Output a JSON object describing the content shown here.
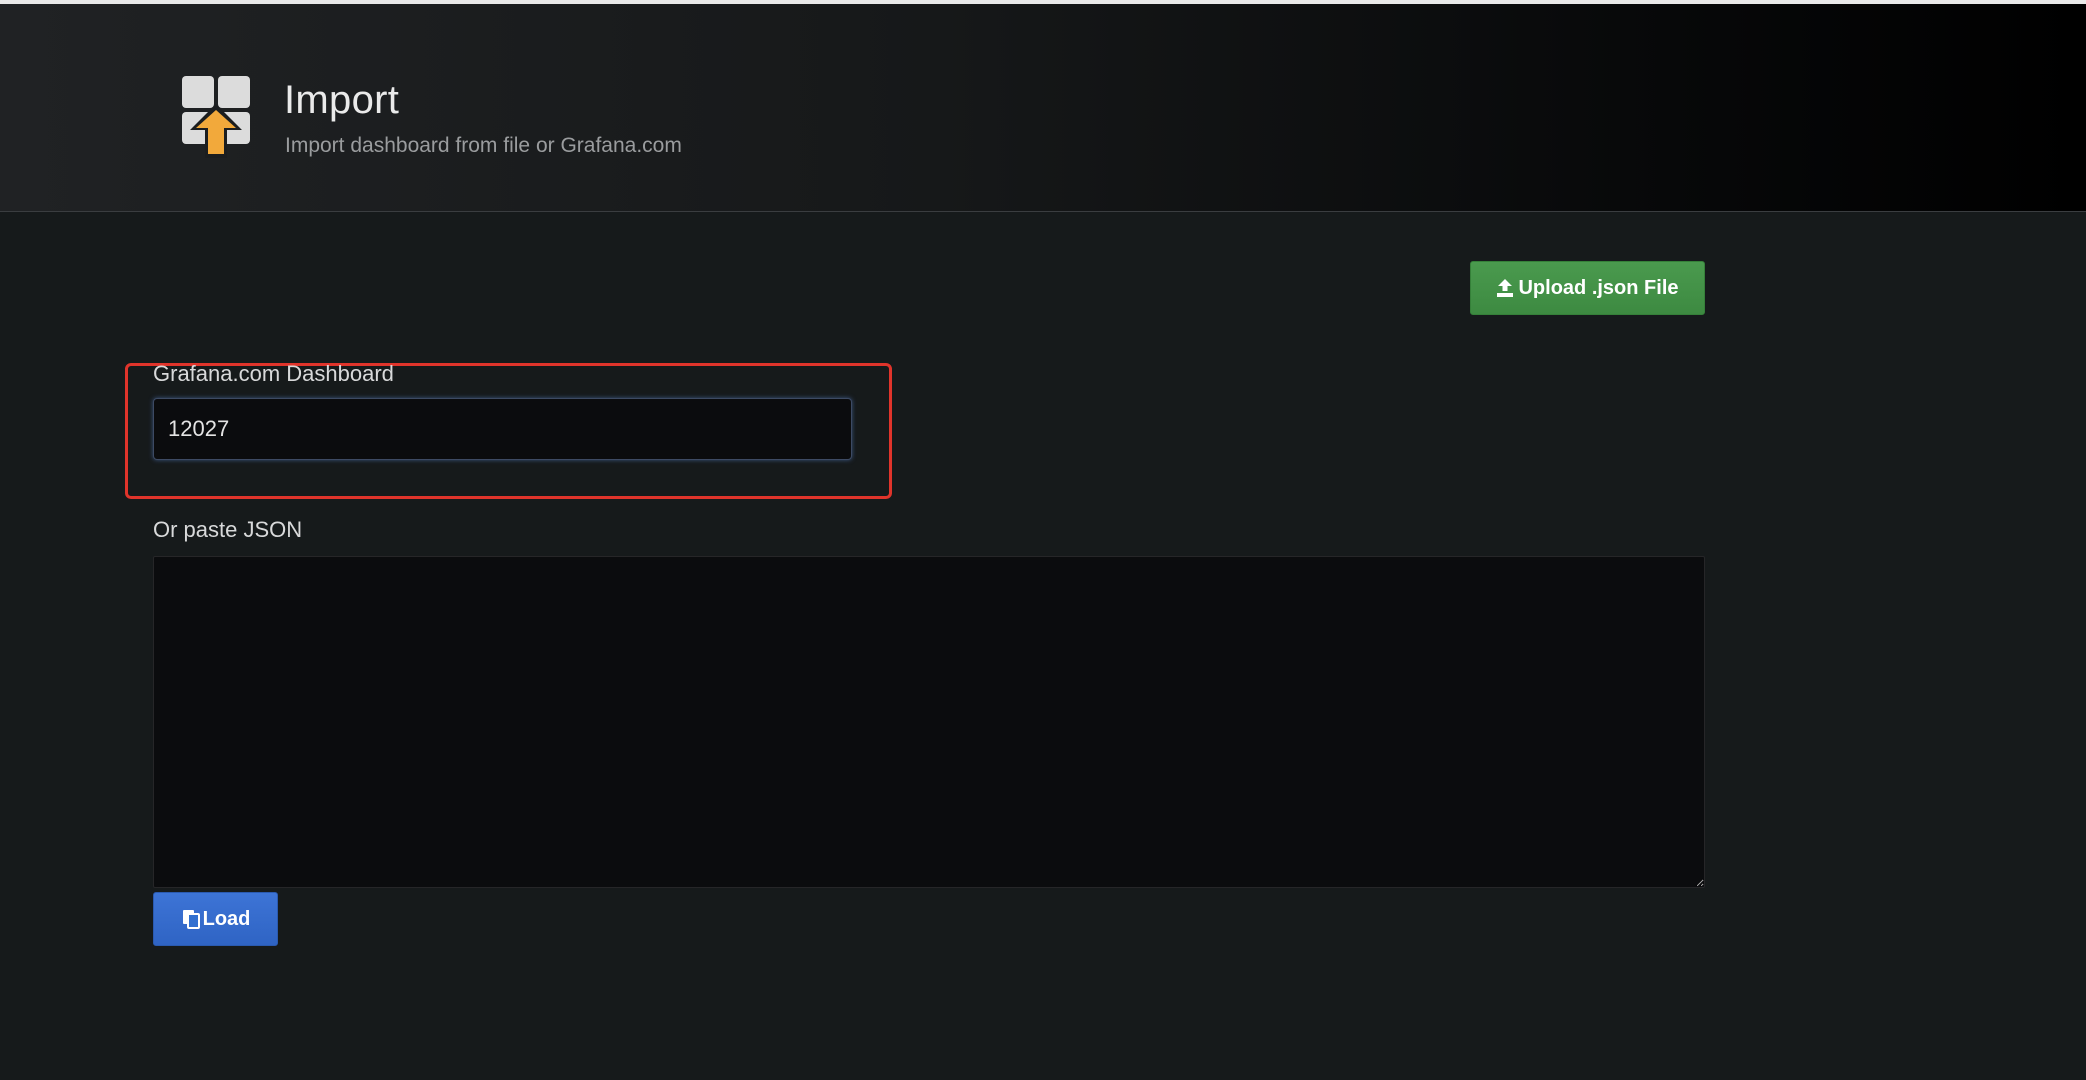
{
  "header": {
    "title": "Import",
    "subtitle": "Import dashboard from file or Grafana.com",
    "icon": "import-dashboard-icon"
  },
  "toolbar": {
    "upload_label": "Upload .json File",
    "upload_icon": "upload-icon"
  },
  "grafana_dashboard": {
    "label": "Grafana.com Dashboard",
    "value": "12027"
  },
  "json": {
    "label": "Or paste JSON",
    "value": ""
  },
  "load": {
    "label": "Load",
    "icon": "copy-icon"
  },
  "colors": {
    "upload_button": "#3d8a41",
    "load_button": "#3270d0",
    "highlight": "#e0342b",
    "icon_arrow": "#f2a93b"
  }
}
